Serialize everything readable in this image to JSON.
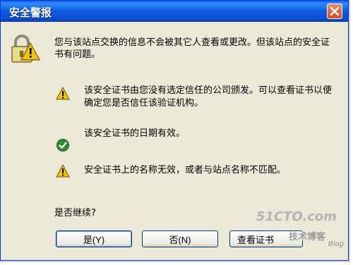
{
  "window": {
    "title": "安全警报"
  },
  "message": {
    "intro": "您与该站点交换的信息不会被其它人查看或更改。但该站点的安全证书有问题。"
  },
  "checks": [
    {
      "icon": "warning-icon",
      "text": "该安全证书由您没有选定信任的公司颁发。可以查看证书以便确定您是否信任该验证机构。"
    },
    {
      "icon": "check-icon",
      "text": "该安全证书的日期有效。"
    },
    {
      "icon": "warning-icon",
      "text": "安全证书上的名称无效，或者与站点名称不匹配。"
    }
  ],
  "prompt": "是否继续?",
  "buttons": {
    "yes": "是(Y)",
    "no": "否(N)",
    "view_cert": "查看证书"
  },
  "watermark": {
    "site": "51CTO.com",
    "label": "技术博客",
    "blog": "Blog"
  },
  "colors": {
    "titlebar": "#0a5fe6",
    "window_bg": "#ece9d8",
    "warning": "#f2c316",
    "check": "#2e8b2e"
  }
}
